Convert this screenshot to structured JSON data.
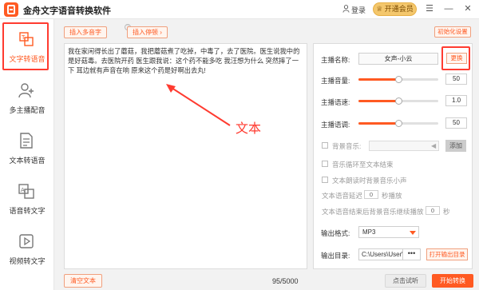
{
  "app": {
    "title": "金舟文字语音转换软件"
  },
  "topbar": {
    "login_label": "登录",
    "vip_label": "开通会员"
  },
  "sidebar": {
    "items": [
      {
        "label": "文字转语音",
        "active": true
      },
      {
        "label": "多主播配音",
        "active": false
      },
      {
        "label": "文本转语音",
        "active": false
      },
      {
        "label": "语音转文字",
        "active": false
      },
      {
        "label": "视频转文字",
        "active": false
      }
    ]
  },
  "editor": {
    "insert_polyphone_label": "插入多音字",
    "insert_pause_label": "插入停顿",
    "text": "我在家闲得长出了蘑菇，我把蘑菇煮了吃掉，中毒了，去了医院。医生说我中的是好菇毒。去医院开药 医生跟我说：这个药不能多吃 我汪想为什么 突然摔了一下 耳边就有声音在响 原来这个药是好啊出去丸!",
    "annotation_label": "文本",
    "clear_label": "清空文本",
    "char_count": "95/5000"
  },
  "settings": {
    "init_label": "初始化设置",
    "anchor_label": "主播名称:",
    "anchor_value": "女声-小云",
    "swap_label": "更换",
    "volume_label": "主播音量:",
    "volume_value": "50",
    "volume_level": 0.5,
    "speed_label": "主播语速:",
    "speed_value": "1.0",
    "speed_level": 0.5,
    "pitch_label": "主播语调:",
    "pitch_value": "50",
    "pitch_level": 0.5,
    "bg_music_label": "背景音乐:",
    "add_label": "添加",
    "loop_label": "音乐循环至文本结束",
    "lower_label": "文本朗读时背景音乐小声",
    "delay_label": "文本语音延迟",
    "delay_value": "0",
    "delay_unit": "秒播放",
    "continue_label": "文本语音结束后背景音乐继续播放",
    "continue_value": "0",
    "continue_unit": "秒",
    "format_label": "输出格式:",
    "format_value": "MP3",
    "dir_label": "输出目录:",
    "dir_value": "C:\\Users\\User\\Desktop",
    "dots_label": "•••",
    "open_dir_label": "打开输出目录"
  },
  "footer": {
    "preview_label": "点击试听",
    "convert_label": "开始转换"
  },
  "colors": {
    "accent": "#ff5a22",
    "highlight": "#ff3b30",
    "vip": "#f4c76c"
  }
}
